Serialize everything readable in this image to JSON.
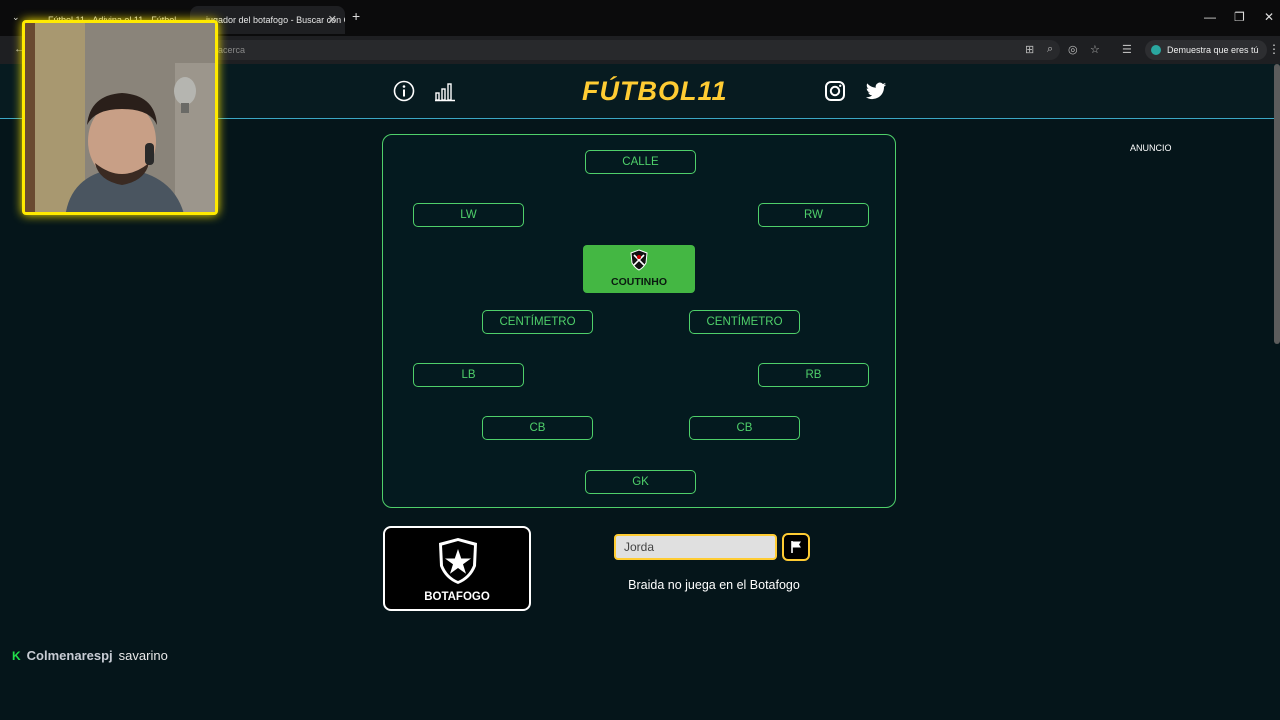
{
  "browser": {
    "tabs": [
      {
        "title": "Fútbol 11 - Adivina el 11 · Fútbol"
      },
      {
        "title": "jugador del botafogo - Buscar con Google"
      }
    ],
    "address_text": "acerca",
    "profile_label": "Demuestra que eres tú"
  },
  "header": {
    "logo_text": "FÚTBOL",
    "logo_number": "11"
  },
  "pitch": {
    "slots": [
      {
        "id": "st",
        "label": "CALLE"
      },
      {
        "id": "lw",
        "label": "LW"
      },
      {
        "id": "rw",
        "label": "RW"
      },
      {
        "id": "cm1",
        "label": "CENTÍMETRO"
      },
      {
        "id": "cm2",
        "label": "CENTÍMETRO"
      },
      {
        "id": "lb",
        "label": "LB"
      },
      {
        "id": "rb",
        "label": "RB"
      },
      {
        "id": "cb1",
        "label": "CB"
      },
      {
        "id": "cb2",
        "label": "CB"
      },
      {
        "id": "gk",
        "label": "GK"
      }
    ],
    "filled_player": "COUTINHO"
  },
  "team": {
    "name": "BOTAFOGO"
  },
  "guess": {
    "value": "Jorda",
    "message": "Braida no juega en el Botafogo"
  },
  "ad_label": "ANUNCIO",
  "chat": {
    "badge": "K",
    "user": "Colmenarespj",
    "text": "savarino"
  },
  "colors": {
    "accent_green": "#4fd06a",
    "accent_yellow": "#ffcc33",
    "background": "#05151a"
  }
}
